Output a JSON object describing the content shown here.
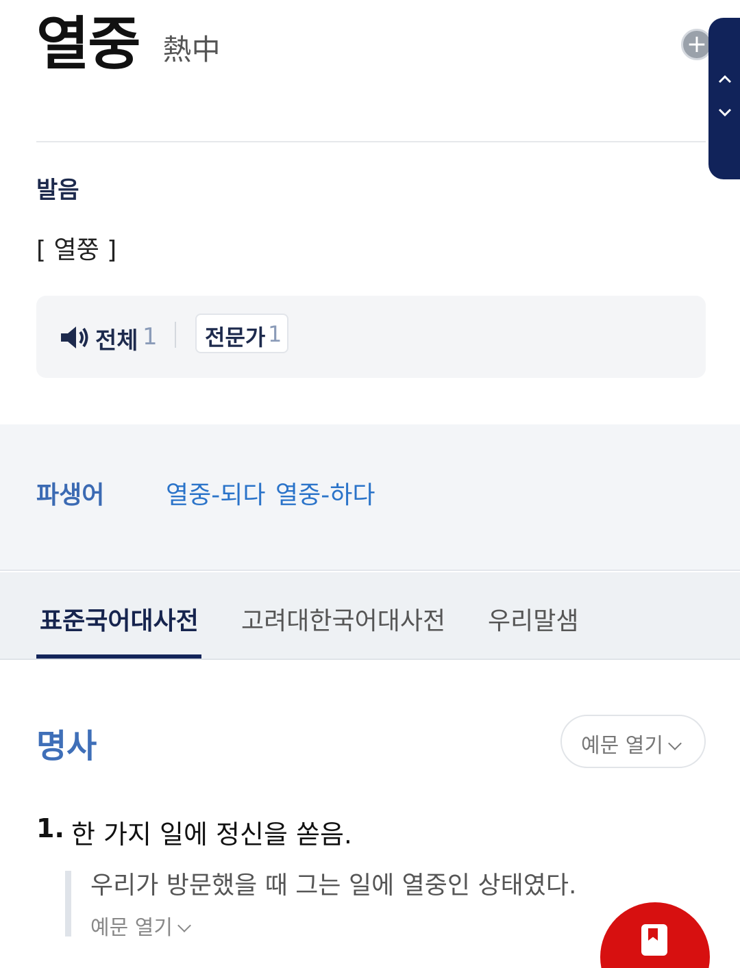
{
  "entry": {
    "word": "열중",
    "hanja": "熱中"
  },
  "pronunciation": {
    "title": "발음",
    "value": "[ 열쭝 ]",
    "all_label": "전체",
    "all_count": "1",
    "expert_label": "전문가",
    "expert_count": "1"
  },
  "derivatives": {
    "title": "파생어",
    "items": [
      "열중-되다",
      "열중-하다"
    ]
  },
  "tabs": [
    "표준국어대사전",
    "고려대한국어대사전",
    "우리말샘"
  ],
  "definition": {
    "pos": "명사",
    "example_button": "예문 열기",
    "senses": [
      {
        "number": "1.",
        "text": "한 가지 일에 정신을 쏟음.",
        "example": "우리가 방문했을 때 그는 일에 열중인 상태였다.",
        "example_toggle": "예문 열기"
      }
    ]
  },
  "colors": {
    "accent_navy": "#13255a",
    "link_blue": "#2a73c9",
    "fab_red": "#d71010"
  }
}
